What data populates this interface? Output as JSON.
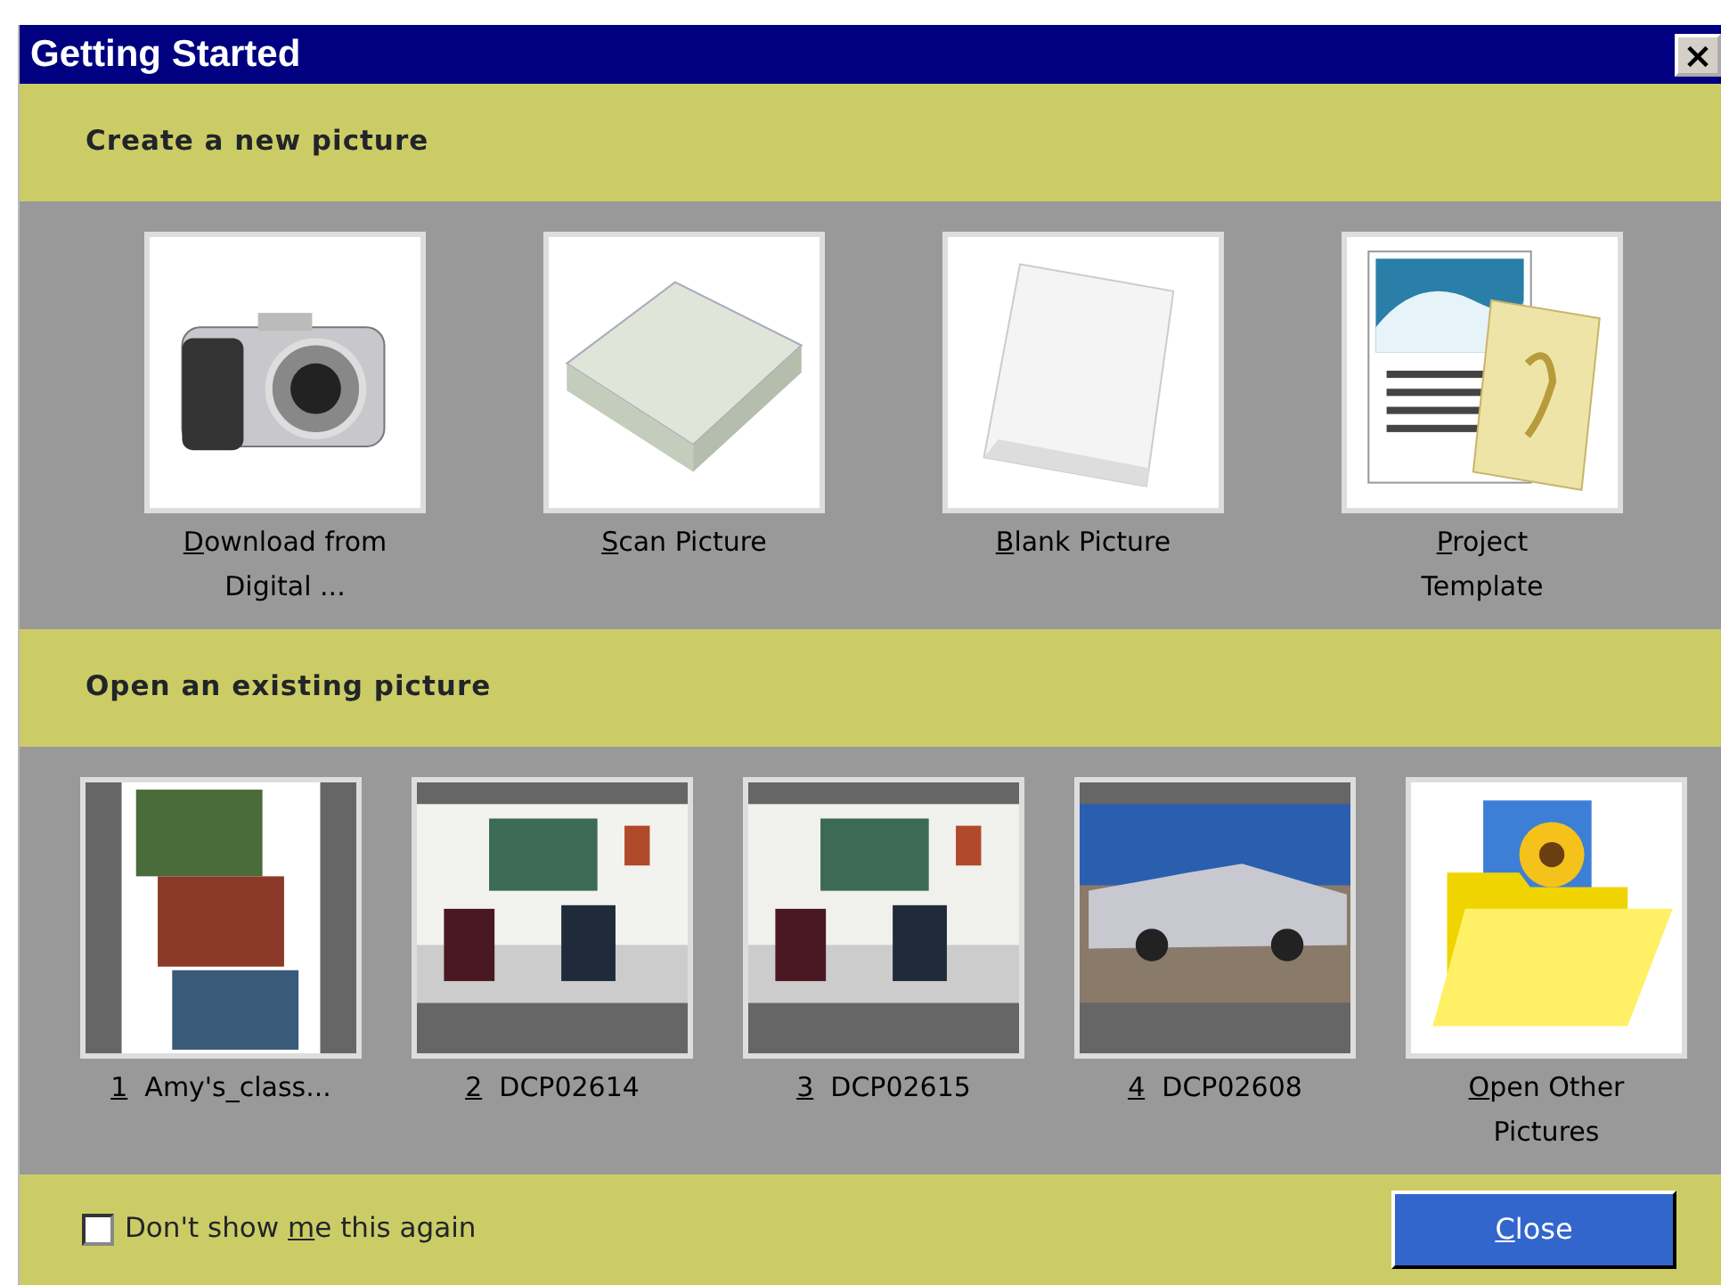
{
  "window": {
    "title": "Getting Started",
    "close_icon": "×"
  },
  "create_section": {
    "heading": "Create a new picture",
    "items": [
      {
        "kind": "camera",
        "key": "D",
        "after": "ownload from Digital ..."
      },
      {
        "kind": "scanner",
        "key": "S",
        "after": "can Picture"
      },
      {
        "kind": "paper",
        "key": "B",
        "after": "lank Picture"
      },
      {
        "kind": "calendar",
        "key": "P",
        "after": "roject Template"
      }
    ]
  },
  "open_section": {
    "heading": "Open an existing picture",
    "items": [
      {
        "number": "1",
        "name": "Amy's_class..."
      },
      {
        "number": "2",
        "name": "DCP02614"
      },
      {
        "number": "3",
        "name": "DCP02615"
      },
      {
        "number": "4",
        "name": "DCP02608"
      },
      {
        "kind": "folder",
        "key": "O",
        "after": "pen Other Pictures"
      }
    ]
  },
  "footer": {
    "checkbox": {
      "before": "Don't show ",
      "key": "m",
      "after": "e this again",
      "checked": false
    },
    "close_button": {
      "key": "C",
      "after": "lose"
    }
  }
}
